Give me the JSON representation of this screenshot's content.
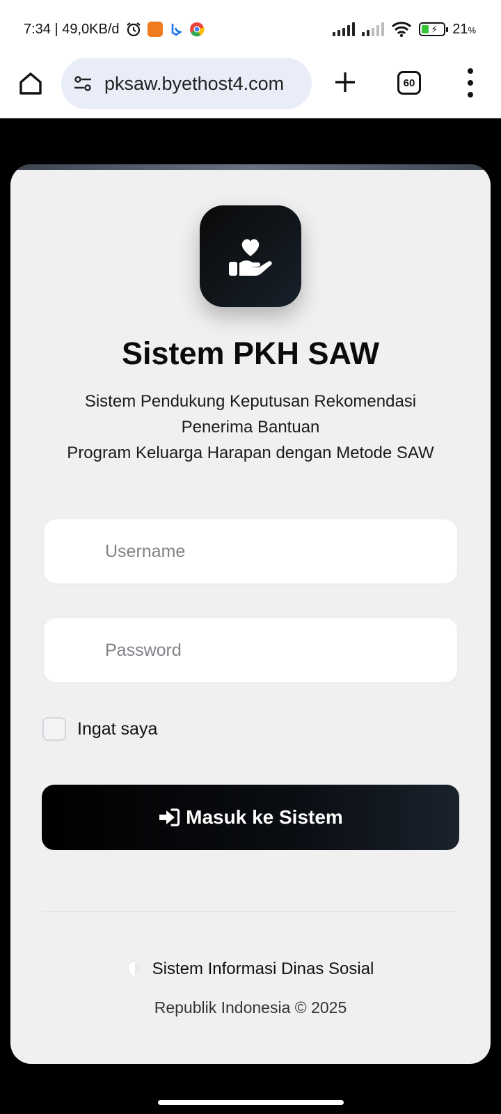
{
  "status_bar": {
    "time_and_speed": "7:34 | 49,0KB/d",
    "battery_percent": "21",
    "battery_unit": "%",
    "icons": [
      "alarm-icon",
      "shop-app-icon",
      "bing-icon",
      "chrome-icon",
      "signal-icon",
      "signal-weak-icon",
      "wifi-icon",
      "battery-charging-icon"
    ]
  },
  "browser": {
    "url": "pksaw.byethost4.com",
    "tab_count": "60",
    "icons": [
      "home-icon",
      "site-settings-icon",
      "plus-icon",
      "more-vert-icon"
    ]
  },
  "login": {
    "logo_icon": "hand-holding-heart-icon",
    "title": "Sistem PKH SAW",
    "subtitle_line1": "Sistem Pendukung Keputusan Rekomendasi",
    "subtitle_line2": "Penerima Bantuan",
    "subtitle_line3": "Program Keluarga Harapan dengan Metode SAW",
    "username_placeholder": "Username",
    "password_placeholder": "Password",
    "remember_label": "Ingat saya",
    "submit_label": "Masuk ke Sistem",
    "submit_icon": "sign-in-icon"
  },
  "footer": {
    "org_line": "Sistem Informasi Dinas Sosial",
    "org_icon": "shield-icon",
    "copyright_line": "Republik Indonesia © 2025"
  },
  "colors": {
    "page_background": "#000000",
    "card_background": "#f0f0f1",
    "primary_button": "#000000",
    "url_pill": "#e8edf7"
  }
}
